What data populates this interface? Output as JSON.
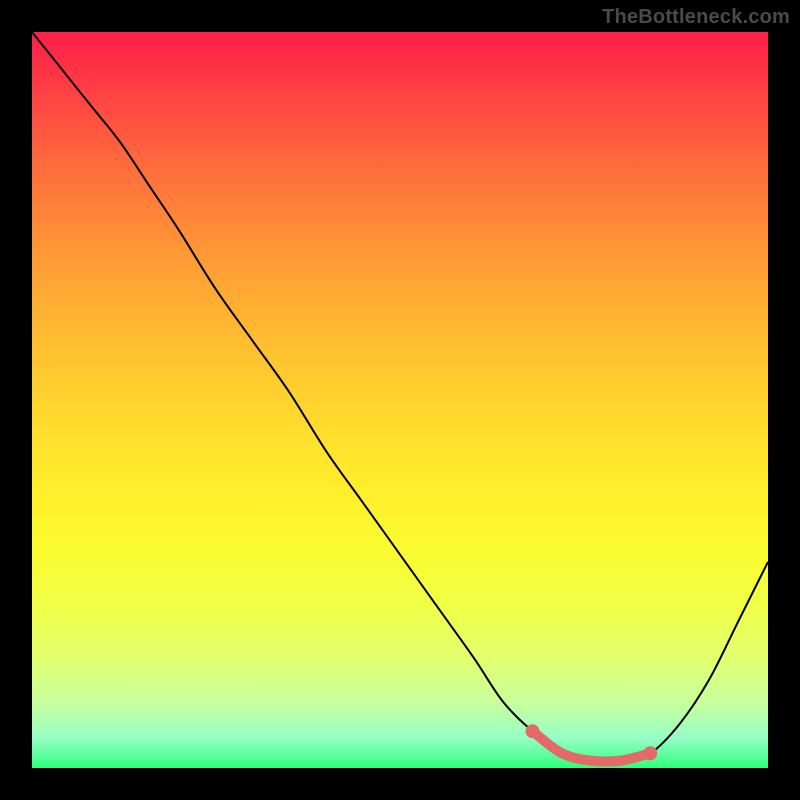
{
  "watermark": "TheBottleneck.com",
  "chart_data": {
    "type": "line",
    "title": "",
    "xlabel": "",
    "ylabel": "",
    "xlim": [
      0,
      100
    ],
    "ylim": [
      0,
      100
    ],
    "grid": false,
    "legend": false,
    "series": [
      {
        "name": "curve",
        "color": "#000000",
        "x": [
          0,
          4,
          8,
          12,
          16,
          20,
          25,
          30,
          35,
          40,
          45,
          50,
          55,
          60,
          64,
          68,
          72,
          76,
          80,
          84,
          88,
          92,
          96,
          100
        ],
        "y": [
          100,
          95,
          90,
          85,
          79,
          73,
          65,
          58,
          51,
          43,
          36,
          29,
          22,
          15,
          9,
          5,
          2,
          1,
          1,
          2,
          6,
          12,
          20,
          28
        ]
      }
    ],
    "highlight": {
      "name": "min-band",
      "color": "#e46a6a",
      "x": [
        68,
        72,
        76,
        80,
        84
      ],
      "y": [
        5,
        2,
        1,
        1,
        2
      ]
    }
  }
}
